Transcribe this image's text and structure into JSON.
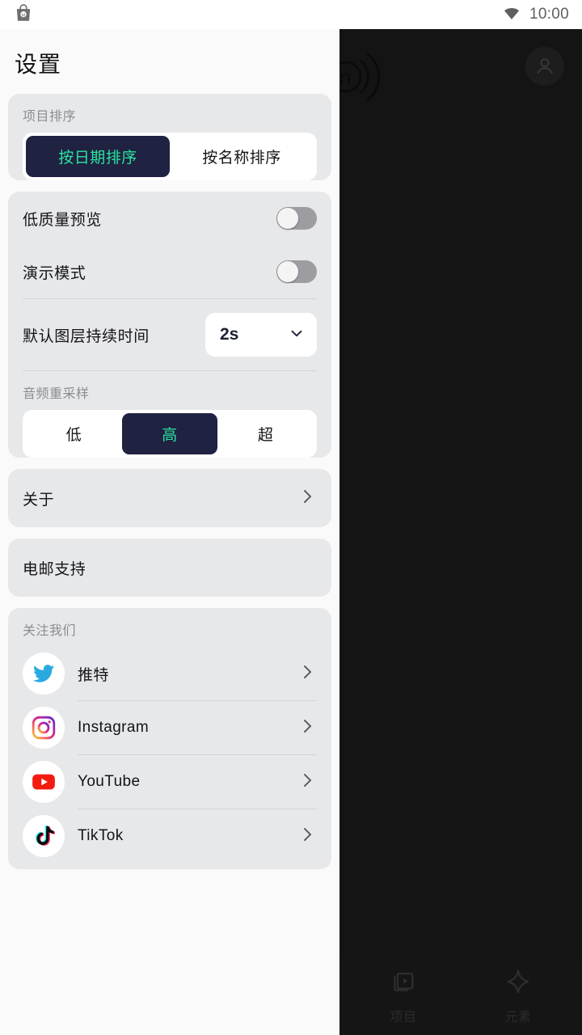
{
  "statusbar": {
    "notification_icon": "shopping-bag-icon",
    "wifi_icon": "wifi-icon",
    "time": "10:00"
  },
  "background_app": {
    "logo_icon": "app-logo-icon",
    "avatar_icon": "account-avatar-icon",
    "bottom_nav": [
      {
        "icon": "media-projects-icon",
        "label": "项目"
      },
      {
        "icon": "sparkle-elements-icon",
        "label": "元素"
      }
    ]
  },
  "drawer": {
    "title": "设置",
    "project_sort": {
      "label": "项目排序",
      "options": [
        "按日期排序",
        "按名称排序"
      ],
      "selected": "按日期排序"
    },
    "preferences": {
      "low_quality_preview": {
        "label": "低质量预览",
        "value": "off"
      },
      "presentation_mode": {
        "label": "演示模式",
        "value": "off"
      },
      "default_layer_duration": {
        "label": "默认图层持续时间",
        "value": "2s",
        "chevron_icon": "chevron-down-icon"
      },
      "audio_resampling": {
        "label": "音频重采样",
        "options": [
          "低",
          "高",
          "超"
        ],
        "selected": "高"
      }
    },
    "about": {
      "label": "关于",
      "chevron_icon": "chevron-right-icon"
    },
    "email_support": {
      "label": "电邮支持"
    },
    "follow_us": {
      "label": "关注我们",
      "items": [
        {
          "label": "推特",
          "icon": "twitter-icon",
          "chevron_icon": "chevron-right-icon"
        },
        {
          "label": "Instagram",
          "icon": "instagram-icon",
          "chevron_icon": "chevron-right-icon"
        },
        {
          "label": "YouTube",
          "icon": "youtube-icon",
          "chevron_icon": "chevron-right-icon"
        },
        {
          "label": "TikTok",
          "icon": "tiktok-icon",
          "chevron_icon": "chevron-right-icon"
        }
      ]
    }
  },
  "colors": {
    "accent_green": "#2ae5a0",
    "accent_navy": "#1f2241",
    "card_bg": "#e7e8ea",
    "drawer_bg": "#fafafa",
    "app_bg": "#141415"
  }
}
